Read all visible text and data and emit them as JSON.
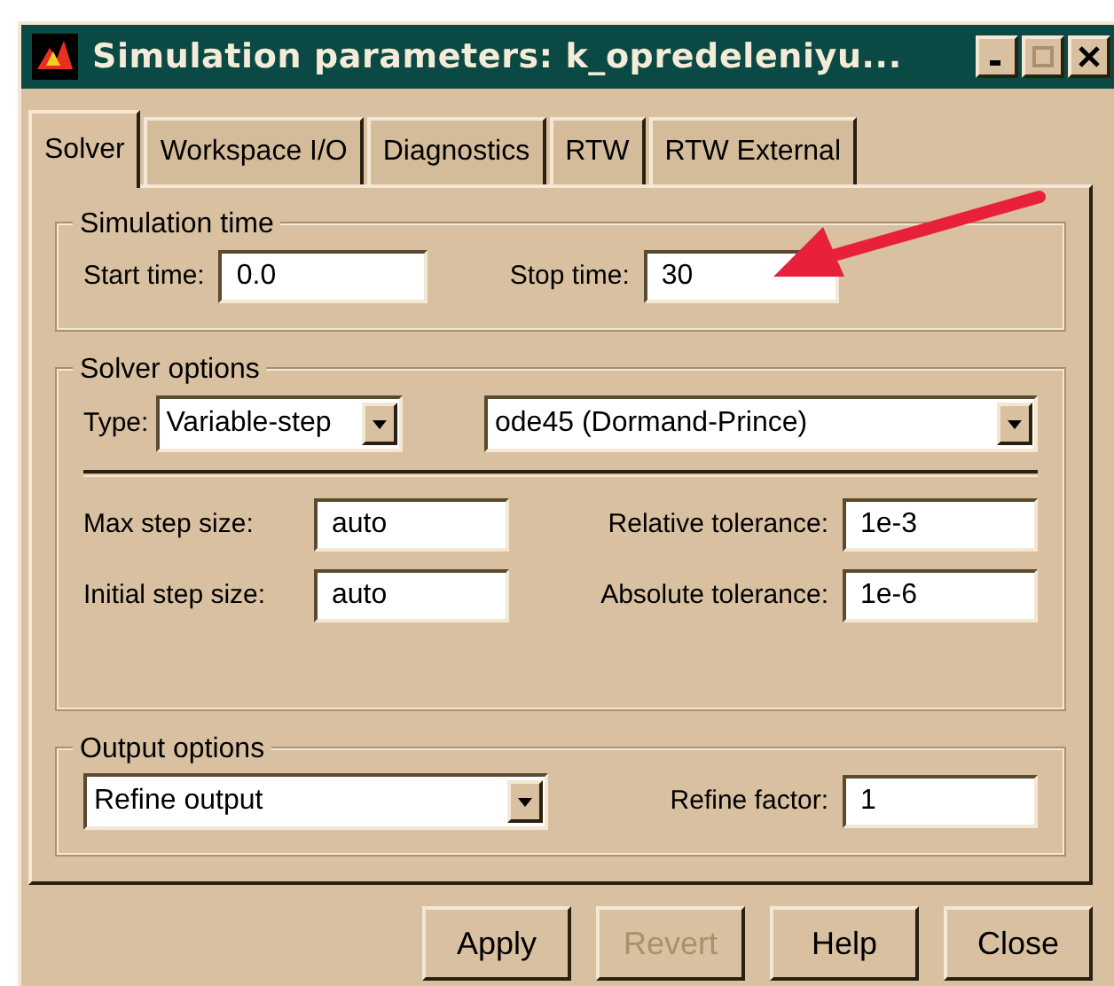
{
  "window": {
    "title": "Simulation parameters: k_opredeleniyu..."
  },
  "tabs": [
    {
      "label": "Solver",
      "selected": true
    },
    {
      "label": "Workspace I/O",
      "selected": false
    },
    {
      "label": "Diagnostics",
      "selected": false
    },
    {
      "label": "RTW",
      "selected": false
    },
    {
      "label": "RTW External",
      "selected": false
    }
  ],
  "simulation_time": {
    "title": "Simulation time",
    "start_label": "Start time:",
    "start_value": "0.0",
    "stop_label": "Stop time:",
    "stop_value": "30"
  },
  "solver_options": {
    "title": "Solver options",
    "type_label": "Type:",
    "type_value": "Variable-step",
    "solver_value": "ode45 (Dormand-Prince)",
    "fields": [
      {
        "label": "Max step size:",
        "value": "auto"
      },
      {
        "label": "Relative tolerance:",
        "value": "1e-3"
      },
      {
        "label": "Initial step size:",
        "value": "auto"
      },
      {
        "label": "Absolute tolerance:",
        "value": "1e-6"
      }
    ]
  },
  "output_options": {
    "title": "Output options",
    "mode_value": "Refine output",
    "factor_label": "Refine factor:",
    "factor_value": "1"
  },
  "buttons": [
    {
      "label": "Apply",
      "disabled": false
    },
    {
      "label": "Revert",
      "disabled": true
    },
    {
      "label": "Help",
      "disabled": false
    },
    {
      "label": "Close",
      "disabled": false
    }
  ]
}
